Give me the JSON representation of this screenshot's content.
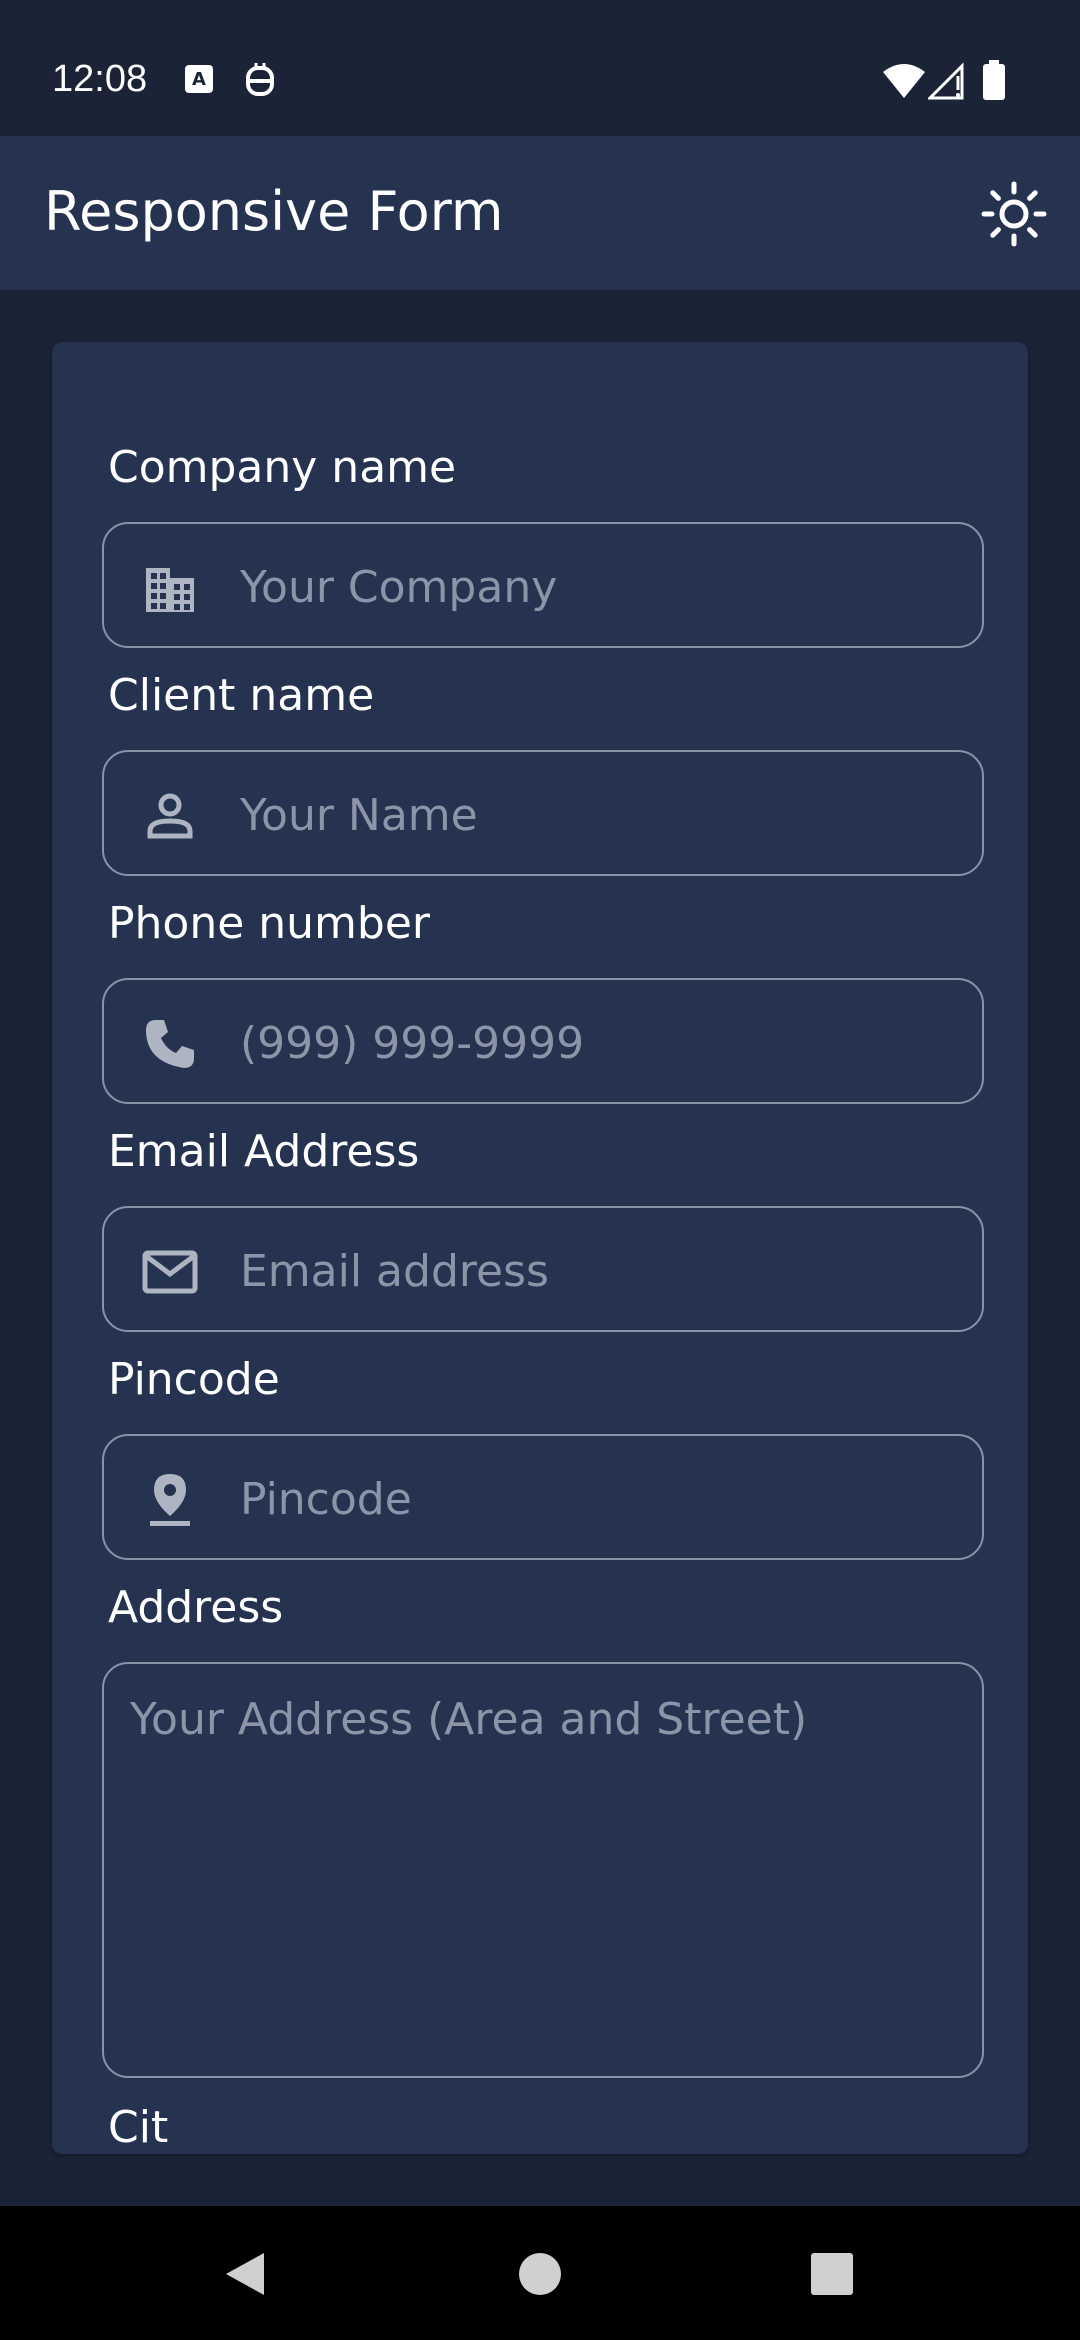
{
  "status_bar": {
    "time": "12:08"
  },
  "app_bar": {
    "title": "Responsive Form",
    "theme_icon": "sun-icon"
  },
  "form": {
    "fields": [
      {
        "label": "Company name",
        "placeholder": "Your Company",
        "icon": "building-icon"
      },
      {
        "label": "Client name",
        "placeholder": "Your Name",
        "icon": "person-icon"
      },
      {
        "label": "Phone number",
        "placeholder": "(999) 999-9999",
        "icon": "phone-icon"
      },
      {
        "label": "Email Address",
        "placeholder": "Email address",
        "icon": "mail-icon"
      },
      {
        "label": "Pincode",
        "placeholder": "Pincode",
        "icon": "location-pin-icon"
      }
    ],
    "address": {
      "label": "Address",
      "placeholder": "Your Address (Area and Street)"
    },
    "next_label_partial": "Cit"
  },
  "colors": {
    "background": "#1b2337",
    "surface": "#253250",
    "text": "#ffffff",
    "placeholder": "#8c95a8",
    "outline": "#8a93a6"
  }
}
